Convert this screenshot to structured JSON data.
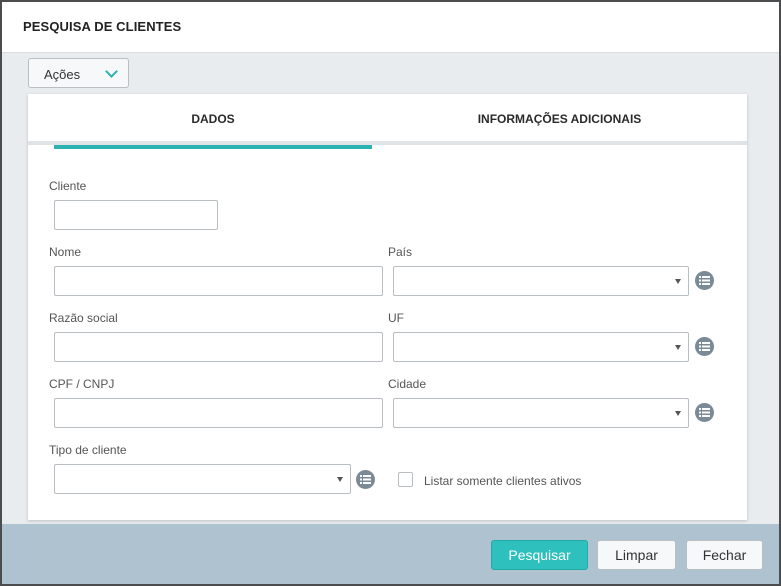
{
  "dialog": {
    "title": "PESQUISA DE CLIENTES"
  },
  "actions": {
    "label": "Ações"
  },
  "tabs": [
    {
      "label": "DADOS",
      "active": true
    },
    {
      "label": "INFORMAÇÕES ADICIONAIS",
      "active": false
    }
  ],
  "form": {
    "cliente": {
      "label": "Cliente",
      "value": ""
    },
    "nome": {
      "label": "Nome",
      "value": ""
    },
    "razao_social": {
      "label": "Razão social",
      "value": ""
    },
    "cpf_cnpj": {
      "label": "CPF / CNPJ",
      "value": ""
    },
    "tipo_cliente": {
      "label": "Tipo de cliente",
      "value": ""
    },
    "pais": {
      "label": "País",
      "value": ""
    },
    "uf": {
      "label": "UF",
      "value": ""
    },
    "cidade": {
      "label": "Cidade",
      "value": ""
    },
    "ativos": {
      "label": "Listar somente clientes ativos",
      "checked": false
    }
  },
  "footer": {
    "search_label": "Pesquisar",
    "clear_label": "Limpar",
    "close_label": "Fechar"
  },
  "colors": {
    "accent": "#2bb3b1",
    "footer_bg": "#aec3cf",
    "list_icon": "#7a8a96"
  }
}
